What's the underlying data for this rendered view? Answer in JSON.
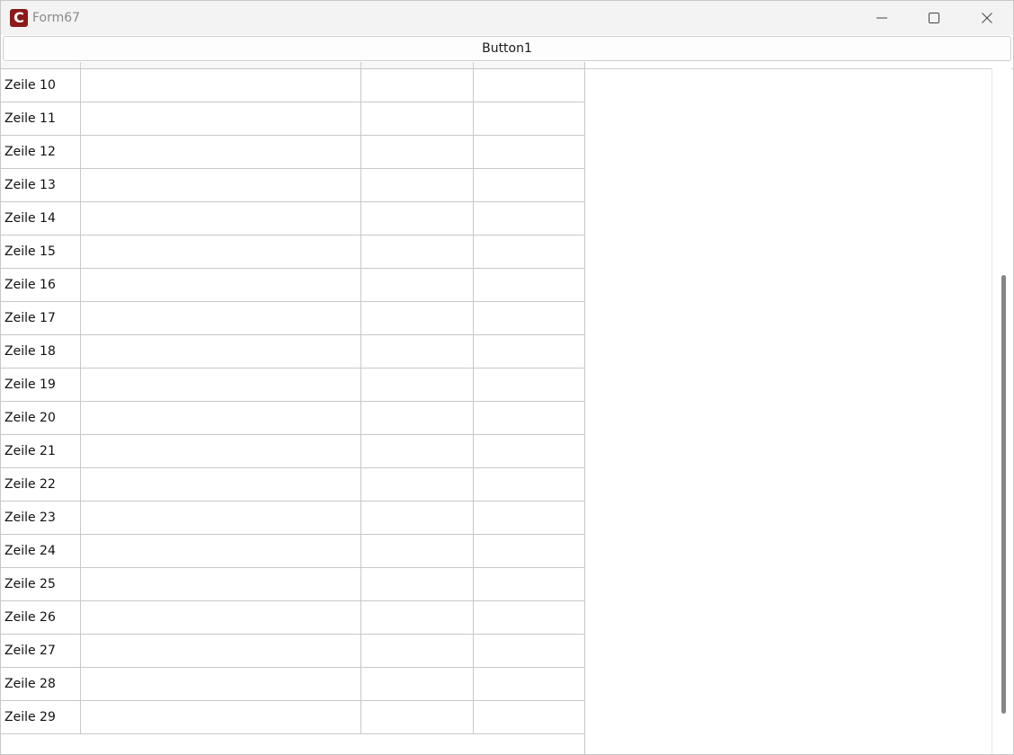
{
  "window": {
    "title": "Form67",
    "app_icon_letter": "C"
  },
  "toolbar": {
    "button1_label": "Button1"
  },
  "grid": {
    "rows": [
      {
        "label": "Zeile 10"
      },
      {
        "label": "Zeile 11"
      },
      {
        "label": "Zeile 12"
      },
      {
        "label": "Zeile 13"
      },
      {
        "label": "Zeile 14"
      },
      {
        "label": "Zeile 15"
      },
      {
        "label": "Zeile 16"
      },
      {
        "label": "Zeile 17"
      },
      {
        "label": "Zeile 18"
      },
      {
        "label": "Zeile 19"
      },
      {
        "label": "Zeile 20"
      },
      {
        "label": "Zeile 21"
      },
      {
        "label": "Zeile 22"
      },
      {
        "label": "Zeile 23"
      },
      {
        "label": "Zeile 24"
      },
      {
        "label": "Zeile 25"
      },
      {
        "label": "Zeile 26"
      },
      {
        "label": "Zeile 27"
      },
      {
        "label": "Zeile 28"
      },
      {
        "label": "Zeile 29"
      }
    ]
  },
  "colors": {
    "app_icon": "#8b1a1a",
    "scroll_thumb": "#858585",
    "grid_line": "#c8c8c8"
  }
}
